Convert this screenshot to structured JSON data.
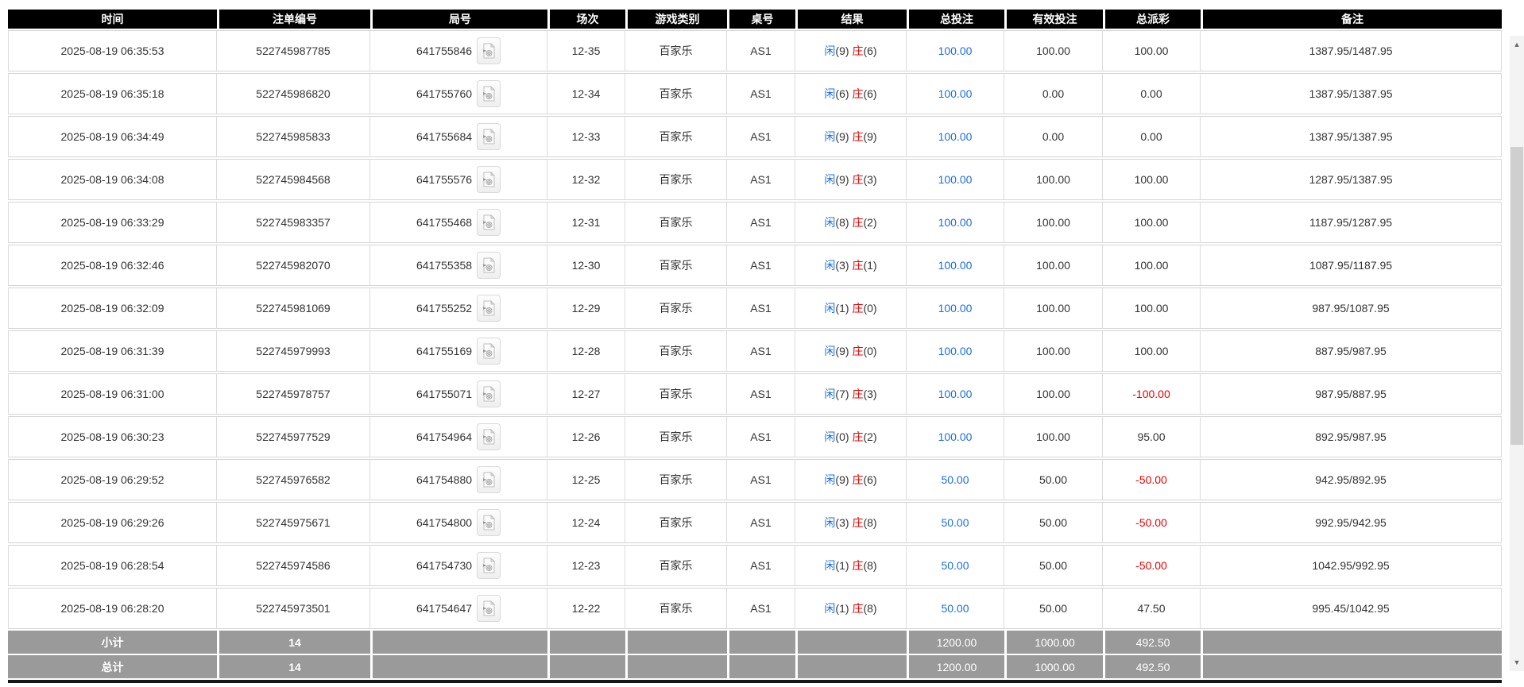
{
  "colors": {
    "header_bg": "#000000",
    "header_text": "#ffffff",
    "link_blue": "#1b6ede",
    "player_blue": "#1b6ede",
    "banker_red": "#e60000",
    "negative_red": "#e60000",
    "summary_bg": "#9a9a9a",
    "row_border": "#d5d5d5"
  },
  "icons": {
    "video": "video-record-icon",
    "scroll_up": "▲",
    "scroll_down": "▼"
  },
  "table": {
    "columns": [
      {
        "label": "时间"
      },
      {
        "label": "注单编号"
      },
      {
        "label": "局号"
      },
      {
        "label": "场次"
      },
      {
        "label": "游戏类别"
      },
      {
        "label": "桌号"
      },
      {
        "label": "结果"
      },
      {
        "label": "总投注"
      },
      {
        "label": "有效投注"
      },
      {
        "label": "总派彩"
      },
      {
        "label": "备注"
      }
    ],
    "rows": [
      {
        "time": "2025-08-19 06:35:53",
        "bet_no": "522745987785",
        "round_no": "641755846",
        "session": "12-35",
        "game": "百家乐",
        "table_no": "AS1",
        "result": {
          "player_label": "闲",
          "player_score": "(9)",
          "banker_label": "庄",
          "banker_score": "(6)"
        },
        "total_bet": "100.00",
        "valid_bet": "100.00",
        "payout": "100.00",
        "remark": "1387.95/1487.95"
      },
      {
        "time": "2025-08-19 06:35:18",
        "bet_no": "522745986820",
        "round_no": "641755760",
        "session": "12-34",
        "game": "百家乐",
        "table_no": "AS1",
        "result": {
          "player_label": "闲",
          "player_score": "(6)",
          "banker_label": "庄",
          "banker_score": "(6)"
        },
        "total_bet": "100.00",
        "valid_bet": "0.00",
        "payout": "0.00",
        "remark": "1387.95/1387.95"
      },
      {
        "time": "2025-08-19 06:34:49",
        "bet_no": "522745985833",
        "round_no": "641755684",
        "session": "12-33",
        "game": "百家乐",
        "table_no": "AS1",
        "result": {
          "player_label": "闲",
          "player_score": "(9)",
          "banker_label": "庄",
          "banker_score": "(9)"
        },
        "total_bet": "100.00",
        "valid_bet": "0.00",
        "payout": "0.00",
        "remark": "1387.95/1387.95"
      },
      {
        "time": "2025-08-19 06:34:08",
        "bet_no": "522745984568",
        "round_no": "641755576",
        "session": "12-32",
        "game": "百家乐",
        "table_no": "AS1",
        "result": {
          "player_label": "闲",
          "player_score": "(9)",
          "banker_label": "庄",
          "banker_score": "(3)"
        },
        "total_bet": "100.00",
        "valid_bet": "100.00",
        "payout": "100.00",
        "remark": "1287.95/1387.95"
      },
      {
        "time": "2025-08-19 06:33:29",
        "bet_no": "522745983357",
        "round_no": "641755468",
        "session": "12-31",
        "game": "百家乐",
        "table_no": "AS1",
        "result": {
          "player_label": "闲",
          "player_score": "(8)",
          "banker_label": "庄",
          "banker_score": "(2)"
        },
        "total_bet": "100.00",
        "valid_bet": "100.00",
        "payout": "100.00",
        "remark": "1187.95/1287.95"
      },
      {
        "time": "2025-08-19 06:32:46",
        "bet_no": "522745982070",
        "round_no": "641755358",
        "session": "12-30",
        "game": "百家乐",
        "table_no": "AS1",
        "result": {
          "player_label": "闲",
          "player_score": "(3)",
          "banker_label": "庄",
          "banker_score": "(1)"
        },
        "total_bet": "100.00",
        "valid_bet": "100.00",
        "payout": "100.00",
        "remark": "1087.95/1187.95"
      },
      {
        "time": "2025-08-19 06:32:09",
        "bet_no": "522745981069",
        "round_no": "641755252",
        "session": "12-29",
        "game": "百家乐",
        "table_no": "AS1",
        "result": {
          "player_label": "闲",
          "player_score": "(1)",
          "banker_label": "庄",
          "banker_score": "(0)"
        },
        "total_bet": "100.00",
        "valid_bet": "100.00",
        "payout": "100.00",
        "remark": "987.95/1087.95"
      },
      {
        "time": "2025-08-19 06:31:39",
        "bet_no": "522745979993",
        "round_no": "641755169",
        "session": "12-28",
        "game": "百家乐",
        "table_no": "AS1",
        "result": {
          "player_label": "闲",
          "player_score": "(9)",
          "banker_label": "庄",
          "banker_score": "(0)"
        },
        "total_bet": "100.00",
        "valid_bet": "100.00",
        "payout": "100.00",
        "remark": "887.95/987.95"
      },
      {
        "time": "2025-08-19 06:31:00",
        "bet_no": "522745978757",
        "round_no": "641755071",
        "session": "12-27",
        "game": "百家乐",
        "table_no": "AS1",
        "result": {
          "player_label": "闲",
          "player_score": "(7)",
          "banker_label": "庄",
          "banker_score": "(3)"
        },
        "total_bet": "100.00",
        "valid_bet": "100.00",
        "payout": "-100.00",
        "remark": "987.95/887.95"
      },
      {
        "time": "2025-08-19 06:30:23",
        "bet_no": "522745977529",
        "round_no": "641754964",
        "session": "12-26",
        "game": "百家乐",
        "table_no": "AS1",
        "result": {
          "player_label": "闲",
          "player_score": "(0)",
          "banker_label": "庄",
          "banker_score": "(2)"
        },
        "total_bet": "100.00",
        "valid_bet": "100.00",
        "payout": "95.00",
        "remark": "892.95/987.95"
      },
      {
        "time": "2025-08-19 06:29:52",
        "bet_no": "522745976582",
        "round_no": "641754880",
        "session": "12-25",
        "game": "百家乐",
        "table_no": "AS1",
        "result": {
          "player_label": "闲",
          "player_score": "(9)",
          "banker_label": "庄",
          "banker_score": "(6)"
        },
        "total_bet": "50.00",
        "valid_bet": "50.00",
        "payout": "-50.00",
        "remark": "942.95/892.95"
      },
      {
        "time": "2025-08-19 06:29:26",
        "bet_no": "522745975671",
        "round_no": "641754800",
        "session": "12-24",
        "game": "百家乐",
        "table_no": "AS1",
        "result": {
          "player_label": "闲",
          "player_score": "(3)",
          "banker_label": "庄",
          "banker_score": "(8)"
        },
        "total_bet": "50.00",
        "valid_bet": "50.00",
        "payout": "-50.00",
        "remark": "992.95/942.95"
      },
      {
        "time": "2025-08-19 06:28:54",
        "bet_no": "522745974586",
        "round_no": "641754730",
        "session": "12-23",
        "game": "百家乐",
        "table_no": "AS1",
        "result": {
          "player_label": "闲",
          "player_score": "(1)",
          "banker_label": "庄",
          "banker_score": "(8)"
        },
        "total_bet": "50.00",
        "valid_bet": "50.00",
        "payout": "-50.00",
        "remark": "1042.95/992.95"
      },
      {
        "time": "2025-08-19 06:28:20",
        "bet_no": "522745973501",
        "round_no": "641754647",
        "session": "12-22",
        "game": "百家乐",
        "table_no": "AS1",
        "result": {
          "player_label": "闲",
          "player_score": "(1)",
          "banker_label": "庄",
          "banker_score": "(8)"
        },
        "total_bet": "50.00",
        "valid_bet": "50.00",
        "payout": "47.50",
        "remark": "995.45/1042.95"
      }
    ],
    "subtotal": {
      "label": "小计",
      "count": "14",
      "total_bet": "1200.00",
      "valid_bet": "1000.00",
      "payout": "492.50"
    },
    "total": {
      "label": "总计",
      "count": "14",
      "total_bet": "1200.00",
      "valid_bet": "1000.00",
      "payout": "492.50"
    }
  }
}
